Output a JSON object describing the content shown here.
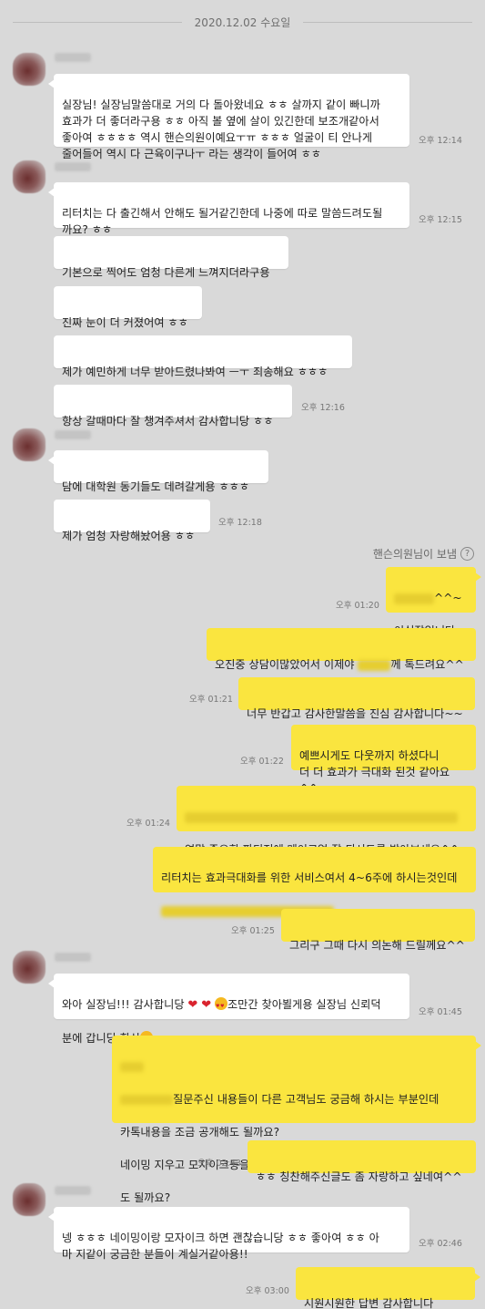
{
  "date_divider": "2020.12.02 수요일",
  "messages": {
    "m1": {
      "text": "실장님! 실장님말씀대로 거의 다 돌아왔네요 ㅎㅎ 살까지 같이 빠니까\n효과가 더 좋더라구용 ㅎㅎ 아직 볼 옆에 살이 있긴한데 보조개같아서\n좋아여 ㅎㅎㅎㅎ 역시 핸슨의원이예요ㅜㅠ ㅎㅎㅎ 얼굴이 티 안나게\n줄어들어 역시 다 근육이구나ㅜ 라는 생각이 들어여 ㅎㅎ",
      "time": "오후 12:14"
    },
    "m2": {
      "text": "리터치는 다 출긴해서 안해도 될거같긴한데 나중에 따로 말씀드려도될\n까요? ㅎㅎ",
      "time": "오후 12:15"
    },
    "m3": {
      "text": "기본으로 찍어도 엄청 다른게 느껴지더라구용"
    },
    "m4": {
      "text": "진짜 눈이 더 커졌어여 ㅎㅎ"
    },
    "m5": {
      "text": "제가 예민하게 너무 받아드렸나봐여 ㅡㅜ 죄송해요 ㅎㅎㅎ"
    },
    "m6": {
      "text": "항상 갈때마다 잘 챙겨주셔서 감사합니당 ㅎㅎ",
      "time": "오후 12:16"
    },
    "m7": {
      "text": "담에 대학원 동기들도 데려갈게용 ㅎㅎㅎ"
    },
    "m8": {
      "text": "제가 엄청 자랑해놨어용 ㅎㅎ",
      "time": "오후 12:18"
    },
    "sent_by": "핸슨의원님이 보냄",
    "r1": {
      "line1_suffix": "^^~",
      "line2": "이실장입니다~",
      "time": "오후 01:20"
    },
    "r2": {
      "prefix": "오진중 상담이많았어서 이제야 ",
      "suffix": "께 톡드려요^^"
    },
    "r3": {
      "text": "너무 반갑고 감사한말씀을 진심 감사합니다~~",
      "time": "오후 01:21"
    },
    "r4": {
      "text": "예쁘시게도 다웃까지 하셨다니\n더 더 효과가 극대화 된것 같아요^^",
      "time": "오후 01:22"
    },
    "r5": {
      "text": "연말 중요한 파티전에 메이크업 잘 되시도록 받아보세요^^",
      "time": "오후 01:24"
    },
    "r6": {
      "text": "리터치는 효과극대화를 위한 서비스여서 4~6주에 하시는것인데"
    },
    "r7": {
      "text": "그리구 그때 다시 의논해 드릴께요^^",
      "time": "오후 01:25"
    },
    "m9": {
      "line1": "와아 실장님!!! 감사합니당",
      "line1_suffix": "조만간 찾아뵐게용 실장님 신뢰덕",
      "line2": "분에 갑니당 항상",
      "time": "오후 01:45"
    },
    "r8": {
      "line3_suffix": "질문주신 내용들이 다른 고객님도 궁금해 하시는 부분인데",
      "line4": "카톡내용을 조금 공개해도 될까요?",
      "line5": "네이밍 지우고 모자이크등을 좀 해서 캡쳐해서 홈페이지 후기란에 올려",
      "line6": "도 될까요?"
    },
    "r9": {
      "text": "ㅎㅎ 칭찬해주신글도 좀 자랑하고 싶네여^^",
      "time": "오후 02:43"
    },
    "m10": {
      "text": "넹 ㅎㅎㅎ 네이밍이랑 모자이크 하면 괜찮습니당 ㅎㅎ 좋아여 ㅎㅎ 아\n마 지같이 궁금한 분들이 계실거같아용!!",
      "time": "오후 02:46"
    },
    "r10": {
      "text": "시원시원한 답변 감사합니다~~^^",
      "time": "오후 03:00"
    }
  },
  "colors": {
    "background": "#d9d9d9",
    "incoming": "#ffffff",
    "outgoing": "#fae53f"
  },
  "icons": [
    "help-icon",
    "heart-icon",
    "heart-eyes-icon"
  ]
}
